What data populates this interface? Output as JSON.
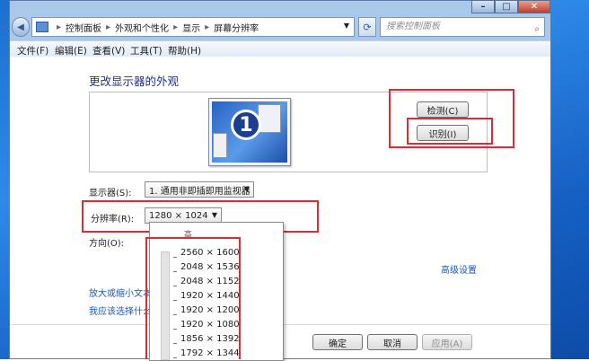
{
  "breadcrumb": [
    "控制面板",
    "外观和个性化",
    "显示",
    "屏幕分辨率"
  ],
  "search_placeholder": "搜索控制面板",
  "menu": [
    "文件(F)",
    "编辑(E)",
    "查看(V)",
    "工具(T)",
    "帮助(H)"
  ],
  "heading": "更改显示器的外观",
  "monitor_number": "1",
  "buttons": {
    "detect": "检测(C)",
    "identify": "识别(I)",
    "ok": "确定",
    "cancel": "取消",
    "apply": "应用(A)"
  },
  "display_label": "显示器(S):",
  "display_value": "1. 通用非即插即用监视器",
  "resolution_label": "分辨率(R):",
  "resolution_value": "1280 × 1024",
  "orientation_label": "方向(O):",
  "advanced_link": "高级设置",
  "link1": "放大或缩小文本",
  "link2": "我应该选择什么",
  "resolution_options": [
    "2560 × 1600",
    "2048 × 1536",
    "2048 × 1152",
    "1920 × 1440",
    "1920 × 1200",
    "1920 × 1080",
    "1856 × 1392",
    "1792 × 1344"
  ],
  "dropdown_top_label": "高",
  "accent": "#e02a35"
}
